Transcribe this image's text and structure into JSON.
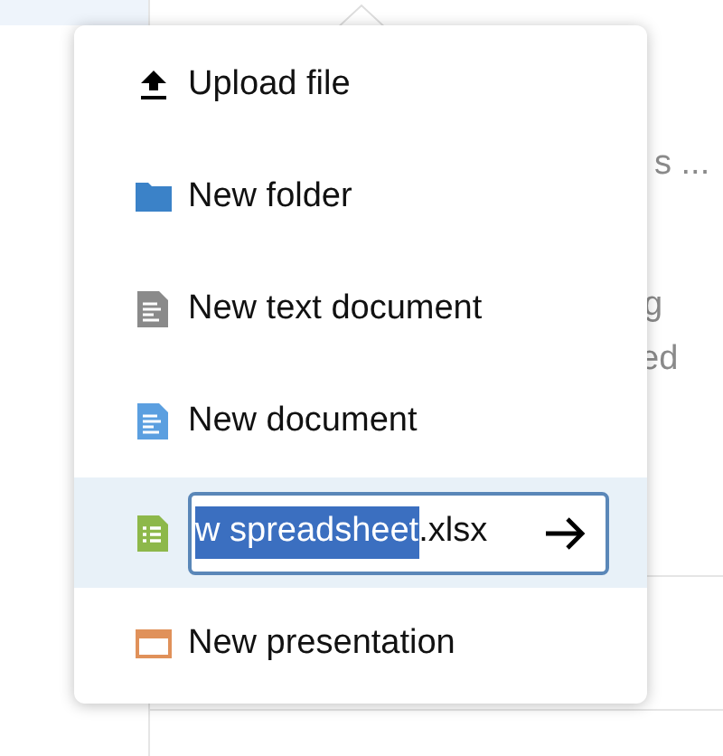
{
  "background": {
    "texts": [
      "s ...",
      "g",
      "ed"
    ]
  },
  "menu": {
    "items": [
      {
        "kind": "action",
        "label": "Upload file"
      },
      {
        "kind": "action",
        "label": "New folder"
      },
      {
        "kind": "action",
        "label": "New text document"
      },
      {
        "kind": "action",
        "label": "New document"
      },
      {
        "kind": "input",
        "selected_text": "w spreadsheet",
        "rest_text": ".xlsx"
      },
      {
        "kind": "action",
        "label": "New presentation"
      }
    ]
  }
}
